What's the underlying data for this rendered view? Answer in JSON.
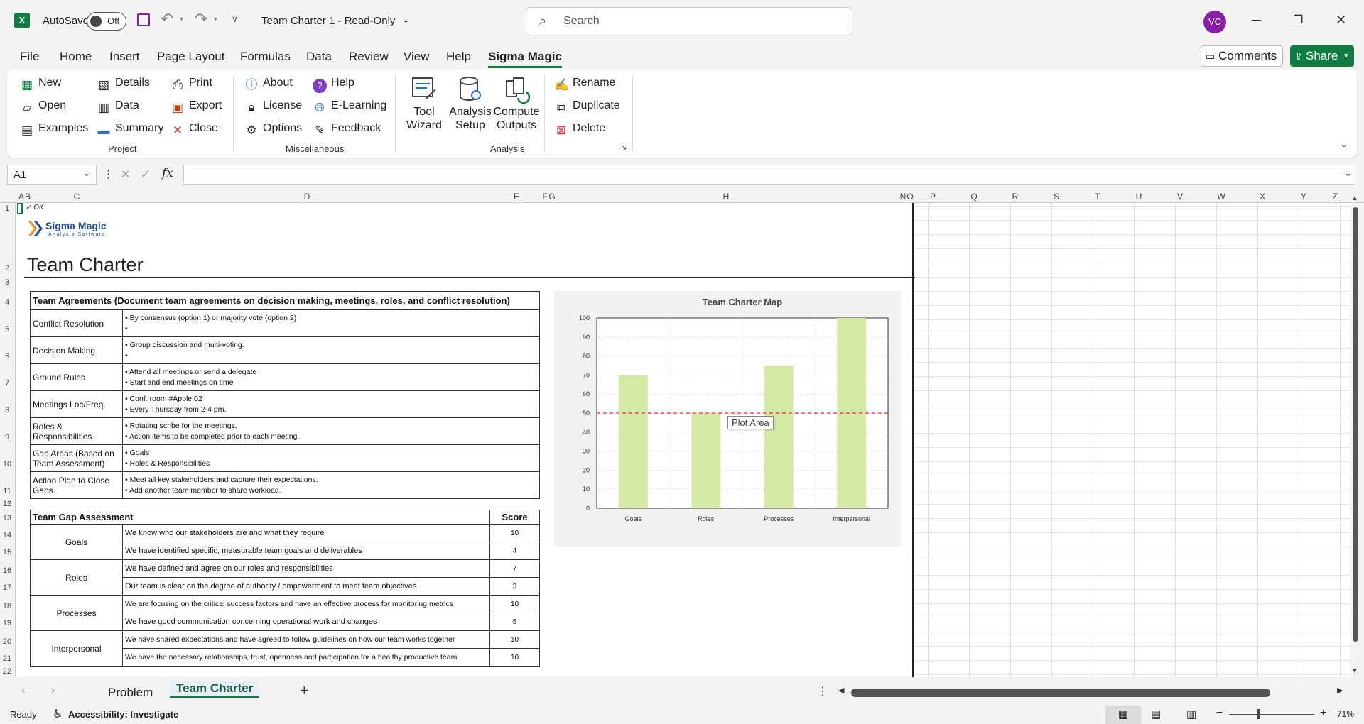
{
  "titlebar": {
    "autosave_label": "AutoSave",
    "autosave_state": "Off",
    "doc_title": "Team Charter 1  -  Read-Only",
    "search_placeholder": "Search",
    "avatar_initials": "VC"
  },
  "menu": {
    "items": [
      "File",
      "Home",
      "Insert",
      "Page Layout",
      "Formulas",
      "Data",
      "Review",
      "View",
      "Help",
      "Sigma Magic"
    ],
    "active": "Sigma Magic",
    "comments_label": "Comments",
    "share_label": "Share"
  },
  "ribbon": {
    "project": {
      "label": "Project",
      "buttons": [
        "New",
        "Open",
        "Examples",
        "Details",
        "Data",
        "Summary",
        "Print",
        "Export",
        "Close"
      ]
    },
    "misc": {
      "label": "Miscellaneous",
      "buttons": [
        "About",
        "License",
        "Options",
        "Help",
        "E-Learning",
        "Feedback"
      ]
    },
    "analysis": {
      "label": "Analysis",
      "big_buttons": [
        [
          "Tool",
          "Wizard"
        ],
        [
          "Analysis",
          "Setup"
        ],
        [
          "Compute",
          "Outputs"
        ]
      ],
      "buttons": [
        "Rename",
        "Duplicate",
        "Delete"
      ]
    }
  },
  "formula_bar": {
    "name_box": "A1",
    "formula": ""
  },
  "columns": [
    "A",
    "B",
    "C",
    "D",
    "E",
    "F",
    "G",
    "H",
    "N",
    "O",
    "P",
    "Q",
    "R",
    "S",
    "T",
    "U",
    "V",
    "W",
    "X",
    "Y",
    "Z"
  ],
  "rows": [
    "1",
    "2",
    "3",
    "4",
    "5",
    "6",
    "7",
    "8",
    "9",
    "10",
    "11",
    "12",
    "13",
    "14",
    "15",
    "16",
    "17",
    "18",
    "19",
    "20",
    "21",
    "22"
  ],
  "sheet": {
    "cell_a1": "✓ OK",
    "logo_name": "Sigma Magic",
    "logo_tagline": "Analysis Software",
    "title": "Team Charter",
    "agreements": {
      "header": "Team Agreements (Document team agreements on decision making, meetings, roles, and conflict resolution)",
      "rows": [
        {
          "label": "Conflict Resolution",
          "lines": [
            "• By consensus (option 1) or majority vote (option 2)",
            "•"
          ]
        },
        {
          "label": "Decision Making",
          "lines": [
            "• Group discussion and multi-voting.",
            "•"
          ]
        },
        {
          "label": "Ground Rules",
          "lines": [
            "• Attend all meetings or send a delegate",
            "• Start and end meetings on time"
          ]
        },
        {
          "label": "Meetings Loc/Freq.",
          "lines": [
            "• Conf. room #Apple 02",
            "• Every Thursday from 2-4 pm."
          ]
        },
        {
          "label": "Roles & Responsibilities",
          "lines": [
            "• Rotating scribe for the meetings.",
            "• Action items to be completed prior to each meeting."
          ]
        },
        {
          "label": "Gap Areas (Based on Team Assessment)",
          "lines": [
            "• Goals",
            "• Roles & Responsibilities"
          ]
        },
        {
          "label": "Action Plan to Close Gaps",
          "lines": [
            "• Meet all key stakeholders and capture their expectations.",
            "• Add another team member  to share workload."
          ]
        }
      ]
    },
    "assessment": {
      "header": "Team Gap Assessment",
      "score_header": "Score",
      "groups": [
        {
          "label": "Goals",
          "items": [
            {
              "text": "We know who our stakeholders are and what they require",
              "score": "10"
            },
            {
              "text": "We have identified specific, measurable team goals and deliverables",
              "score": "4"
            }
          ]
        },
        {
          "label": "Roles",
          "items": [
            {
              "text": "We have defined and agree on our roles and responsibilities",
              "score": "7"
            },
            {
              "text": "Our team is clear on the degree of authority / empowerment to meet team objectives",
              "score": "3"
            }
          ]
        },
        {
          "label": "Processes",
          "items": [
            {
              "text": "We are focusing on the critical success factors and have an effective process for monitoring metrics",
              "score": "10"
            },
            {
              "text": "We have good communication concerning operational work and changes",
              "score": "5"
            }
          ]
        },
        {
          "label": "Interpersonal",
          "items": [
            {
              "text": "We have shared expectations and have agreed to follow guidelines on how our team works together",
              "score": "10"
            },
            {
              "text": "We have the necessary relationships, trust, openness and participation for a healthy productive team",
              "score": "10"
            }
          ]
        }
      ]
    },
    "tooltip": "Plot Area"
  },
  "chart_data": {
    "type": "bar",
    "title": "Team Charter Map",
    "categories": [
      "Goals",
      "Roles",
      "Processes",
      "Interpersonal"
    ],
    "values": [
      70,
      50,
      75,
      100
    ],
    "reference_line": 50,
    "ylim": [
      0,
      100
    ],
    "yticks": [
      "0",
      "10",
      "20",
      "30",
      "40",
      "50",
      "60",
      "70",
      "80",
      "90",
      "100"
    ],
    "bar_color": "#d4e9a6",
    "reference_color": "#e05050",
    "grid": true
  },
  "tabs": {
    "items": [
      "Problem",
      "Team Charter"
    ],
    "active": "Team Charter"
  },
  "status": {
    "ready": "Ready",
    "accessibility": "Accessibility: Investigate",
    "zoom": "71%"
  },
  "colors": {
    "accent": "#107c41",
    "avatar": "#8b1ea8"
  }
}
